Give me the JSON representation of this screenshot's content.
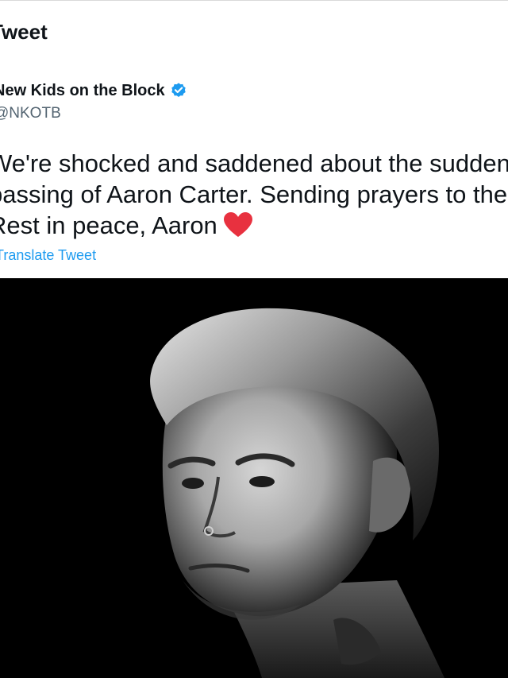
{
  "header": {
    "title": "Tweet"
  },
  "author": {
    "name": "New Kids on the Block",
    "handle": "@NKOTB",
    "verified_icon": "verified-badge-icon",
    "verified_color": "#1d9bf0"
  },
  "tweet": {
    "lines": [
      "We're shocked and saddened about the sudden",
      "passing of Aaron Carter. Sending prayers to the Carter family.",
      "Rest in peace, Aaron"
    ],
    "emoji_icon": "red-heart-icon",
    "emoji_color": "#e8313f",
    "translate_label": "Translate Tweet"
  },
  "photo": {
    "style": "black-and-white portrait of a man"
  },
  "colors": {
    "text": "#0f1419",
    "muted": "#536471",
    "link": "#1d9bf0",
    "photo_background": "#000000"
  }
}
